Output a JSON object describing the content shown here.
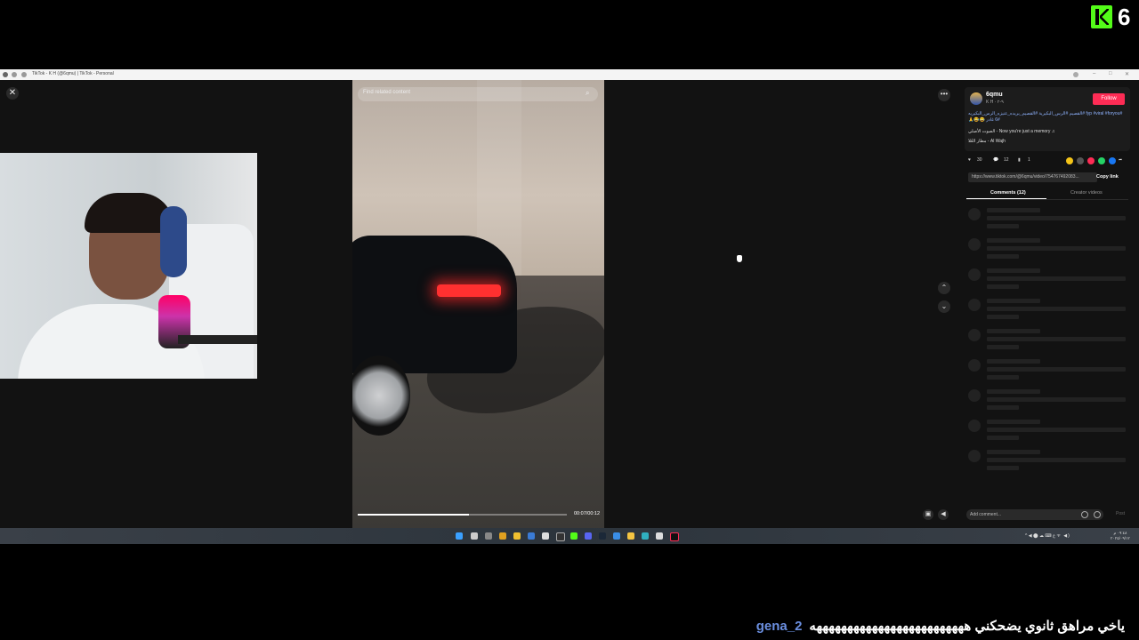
{
  "overlay": {
    "brand_number": "6"
  },
  "browser": {
    "tab_title": "TikTok - K H (@6qmu) | TikTok - Personal"
  },
  "video": {
    "search_placeholder": "Find related content",
    "time": "00:07/00:12",
    "progress": 0.53
  },
  "post": {
    "username": "6qmu",
    "subname": "K H · ٩-٢",
    "follow_label": "Follow",
    "caption": "#fyp #viral #foryou #القصيم #الرس_البكيرية #القصيم_بريده_عنيزه_الرس_البكيريه #6 غادر 😂😂🙏",
    "music": "الصوت الأصلي - Now you're just a memory ♫",
    "location": "مطار العُلا - Al Wajh",
    "likes": "30",
    "comments": "12",
    "saves": "1",
    "link": "https://www.tiktok.com/@6qmu/video/754767492083...",
    "copy_label": "Copy link",
    "tab_comments": "Comments (12)",
    "tab_creator": "Creator videos",
    "add_comment_placeholder": "Add comment...",
    "post_label": "Post"
  },
  "taskbar": {
    "tray": "^ ◀ ⬤ ☁ ⌨ ع ᯤ ◀)",
    "clock_time": "٠٩:٤٨ م",
    "clock_date": "٢٠٢٥/٠٩/١٢"
  },
  "chat": {
    "user": "gena_2",
    "message": "ياخي مراهق ثانوي يضحكني هههههههههههههههههههههههههه"
  },
  "icons": {
    "close": "close-icon",
    "more": "more-icon",
    "up": "chevron-up-icon",
    "down": "chevron-down-icon",
    "mute": "volume-icon",
    "pip": "picture-in-picture-icon",
    "search": "search-icon"
  },
  "colors": {
    "follow": "#fe2c55",
    "kick": "#53fc18",
    "chat_user": "#6b8fe0"
  }
}
